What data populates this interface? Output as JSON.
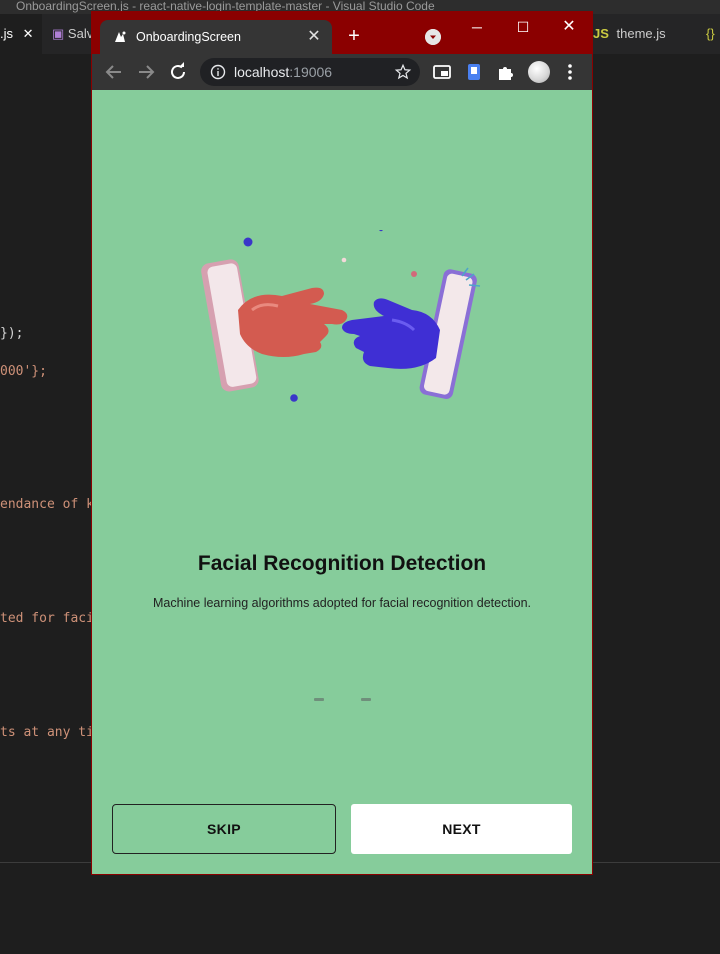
{
  "vscode": {
    "title": "OnboardingScreen.js - react-native-login-template-master - Visual Studio Code",
    "tabs": [
      {
        "label": ".js"
      },
      {
        "label": "Salv"
      },
      {
        "label": "theme.js"
      },
      {
        "label": "{}"
      }
    ],
    "code_fragments": [
      "});",
      "000'};",
      "endance of k",
      "ted for faci",
      "ts at any ti"
    ]
  },
  "browser": {
    "tab_title": "OnboardingScreen",
    "url_host": "localhost",
    "url_port": ":19006"
  },
  "onboarding": {
    "title": "Facial Recognition Detection",
    "description": "Machine learning algorithms adopted for facial recognition detection.",
    "dots_count": 2,
    "skip_label": "SKIP",
    "next_label": "NEXT"
  },
  "colors": {
    "page_background": "#86cc9b",
    "browser_frame": "#8b0000",
    "next_button": "#ffffff"
  }
}
